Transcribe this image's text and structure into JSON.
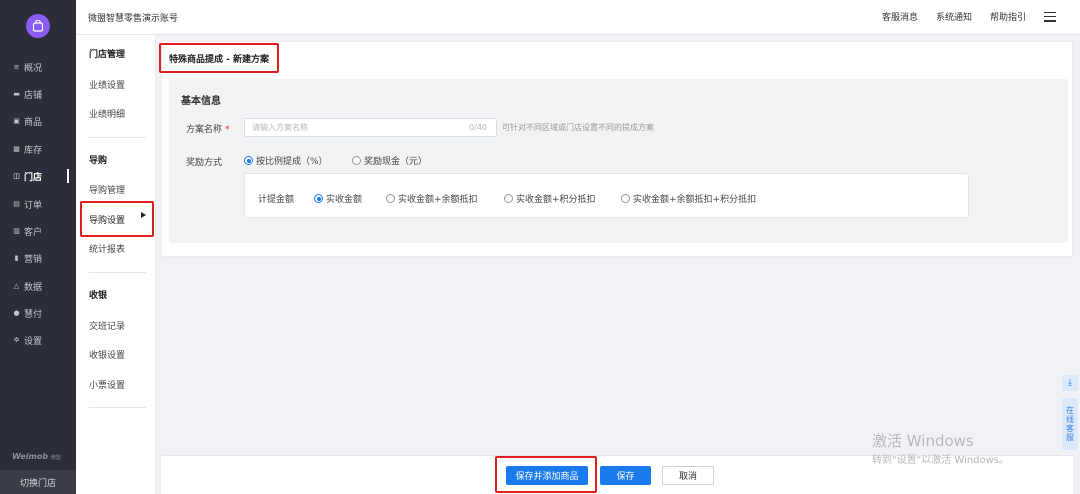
{
  "nav": {
    "items": [
      {
        "label": "概况",
        "icon": "overview-icon"
      },
      {
        "label": "店铺",
        "icon": "store-icon"
      },
      {
        "label": "商品",
        "icon": "goods-icon"
      },
      {
        "label": "库存",
        "icon": "inventory-icon"
      },
      {
        "label": "门店",
        "icon": "shop-icon"
      },
      {
        "label": "订单",
        "icon": "order-icon"
      },
      {
        "label": "客户",
        "icon": "customer-icon"
      },
      {
        "label": "营销",
        "icon": "marketing-icon"
      },
      {
        "label": "数据",
        "icon": "data-icon"
      },
      {
        "label": "慧付",
        "icon": "pay-icon"
      },
      {
        "label": "设置",
        "icon": "settings-icon"
      }
    ],
    "active": "门店",
    "brand": "Weimob",
    "brand_small": "微盟",
    "switch_store": "切换门店"
  },
  "header": {
    "title": "微盟智慧零售演示账号",
    "links": [
      "客服消息",
      "系统通知",
      "帮助指引"
    ]
  },
  "subnav": {
    "groups": [
      {
        "title": "门店管理",
        "items": [
          "业绩设置",
          "业绩明细"
        ]
      },
      {
        "title": "导购",
        "items": [
          "导购管理",
          "导购设置",
          "统计报表"
        ]
      },
      {
        "title": "收银",
        "items": [
          "交班记录",
          "收银设置",
          "小票设置"
        ]
      }
    ],
    "active": "导购设置"
  },
  "page": {
    "title": "特殊商品提成 - 新建方案",
    "section_title": "基本信息",
    "plan_name_label": "方案名称",
    "plan_name_required": "*",
    "plan_name_placeholder": "请输入方案名称",
    "plan_name_value": "",
    "plan_name_count": "0/40",
    "plan_name_hint": "可针对不同区域或门店设置不同的提成方案",
    "reward_label": "奖励方式",
    "reward_options": [
      "按比例提成（%）",
      "奖励现金（元）"
    ],
    "reward_selected": "按比例提成（%）",
    "calc_label": "计提金额",
    "calc_options": [
      "实收金额",
      "实收金额+余额抵扣",
      "实收金额+积分抵扣",
      "实收金额+余额抵扣+积分抵扣"
    ],
    "calc_selected": "实收金额"
  },
  "footer": {
    "save_add_label": "保存并添加商品",
    "save_label": "保存",
    "cancel_label": "取消"
  },
  "float": {
    "download_icon": "download-icon",
    "service_label": "在线客服"
  },
  "watermark": {
    "title": "激活 Windows",
    "subtitle": "转到\"设置\"以激活 Windows。"
  },
  "colors": {
    "nav_bg": "#2b2e38",
    "primary": "#1a7bf0",
    "highlight": "#e02020",
    "logo": "#8a5cf6"
  }
}
